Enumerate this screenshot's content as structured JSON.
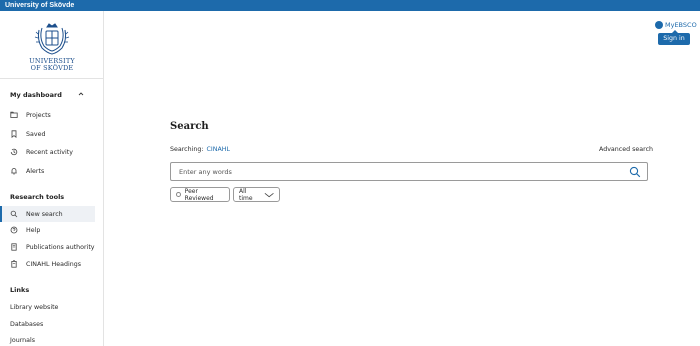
{
  "header": {
    "institution": "University of Skövde"
  },
  "sidebar": {
    "logo": {
      "line1": "UNIVERSITY",
      "line2": "OF SKÖVDE"
    },
    "dashboard": {
      "heading": "My dashboard",
      "items": [
        {
          "label": "Projects",
          "icon": "folder-icon"
        },
        {
          "label": "Saved",
          "icon": "bookmark-icon"
        },
        {
          "label": "Recent activity",
          "icon": "history-icon"
        },
        {
          "label": "Alerts",
          "icon": "bell-icon"
        }
      ]
    },
    "research_tools": {
      "heading": "Research tools",
      "items": [
        {
          "label": "New search",
          "icon": "search-icon",
          "active": true
        },
        {
          "label": "Help",
          "icon": "help-icon"
        },
        {
          "label": "Publications authority",
          "icon": "book-icon"
        },
        {
          "label": "CINAHL Headings",
          "icon": "headings-icon"
        }
      ]
    },
    "links": {
      "heading": "Links",
      "items": [
        {
          "label": "Library website"
        },
        {
          "label": "Databases"
        },
        {
          "label": "Journals"
        }
      ]
    }
  },
  "account": {
    "myebsco_label": "MyEBSCO",
    "signin_label": "Sign in"
  },
  "main": {
    "title": "Search",
    "searching_label": "Searching:",
    "database": "CINAHL",
    "advanced_search": "Advanced search",
    "search": {
      "placeholder": "Enter any words",
      "value": ""
    },
    "filters": {
      "peer_reviewed": "Peer Reviewed",
      "time_range": "All time"
    }
  },
  "colors": {
    "brand_blue": "#1d6aab",
    "border": "#9a9a9a"
  }
}
